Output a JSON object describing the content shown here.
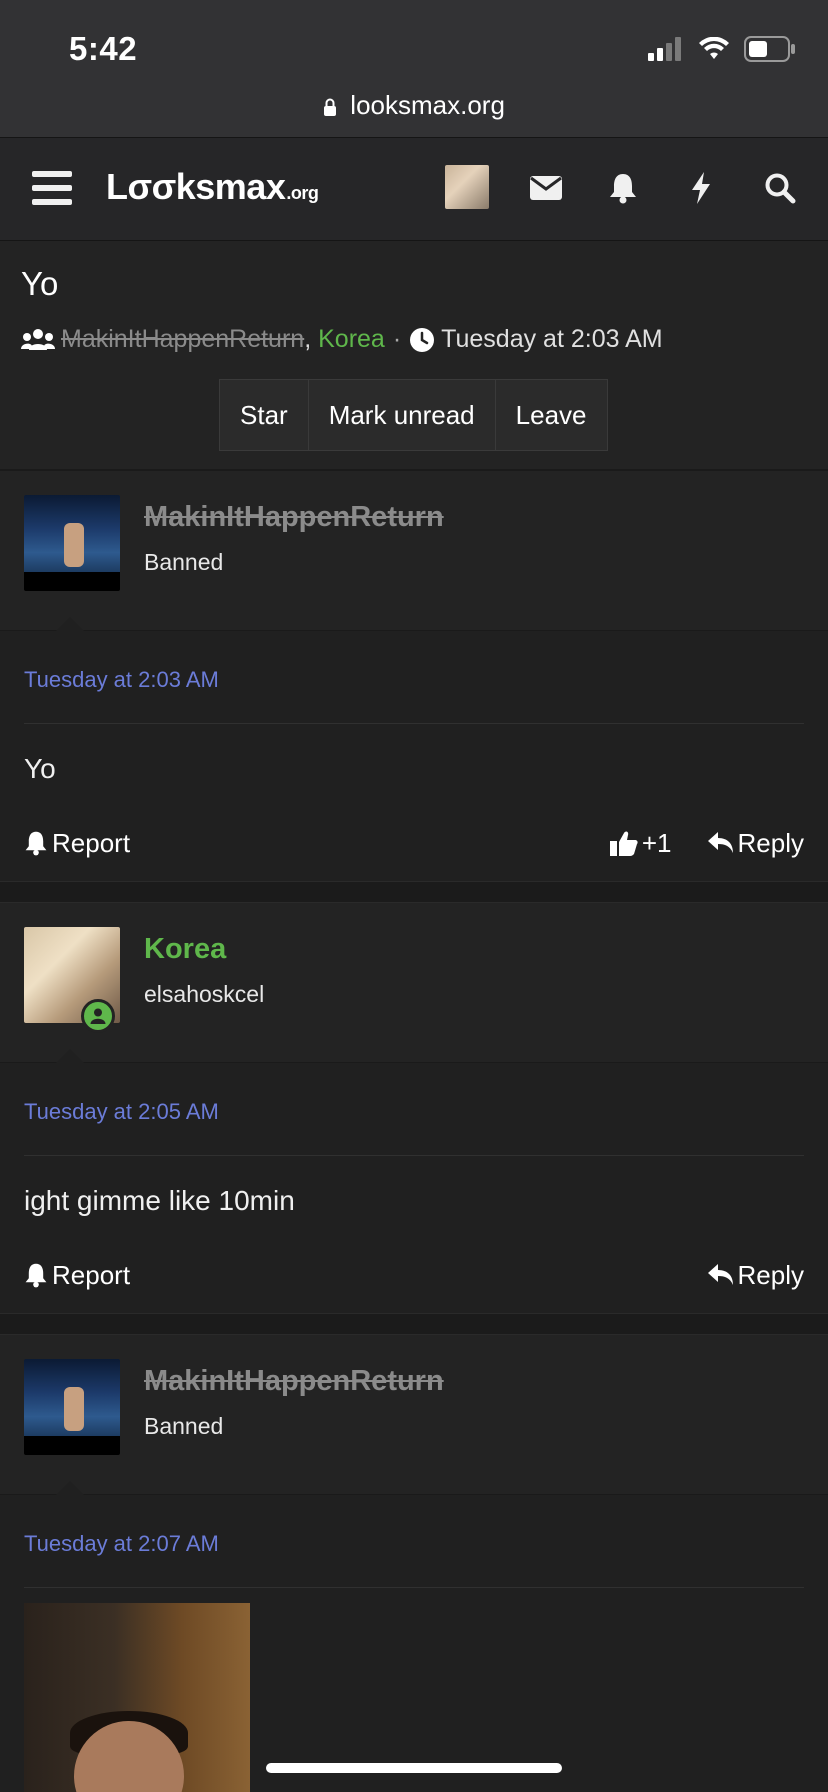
{
  "status_bar": {
    "time": "5:42"
  },
  "browser": {
    "url": "looksmax.org"
  },
  "site_nav": {
    "logo": "Lσσksmax",
    "logo_suffix": ".org"
  },
  "conversation": {
    "title": "Yo",
    "participants": [
      "MakinItHappenReturn",
      "Korea"
    ],
    "participant_sep": ", ",
    "dot": "·",
    "started": "Tuesday at 2:03 AM",
    "buttons": [
      "Star",
      "Mark unread",
      "Leave"
    ]
  },
  "messages": [
    {
      "username": "MakinItHappenReturn",
      "user_title": "Banned",
      "date": "Tuesday at 2:03 AM",
      "body": "Yo",
      "report_label": "Report",
      "reaction_count": "+1",
      "reply_label": "Reply"
    },
    {
      "username": "Korea",
      "user_title": "elsahoskcel",
      "date": "Tuesday at 2:05 AM",
      "body": "ight gimme like 10min",
      "report_label": "Report",
      "reply_label": "Reply"
    },
    {
      "username": "MakinItHappenReturn",
      "user_title": "Banned",
      "date": "Tuesday at 2:07 AM"
    }
  ],
  "colors": {
    "accent_link": "#6b7cd8",
    "online_green": "#5fb74b",
    "banned_gray": "#8b8b8b"
  }
}
